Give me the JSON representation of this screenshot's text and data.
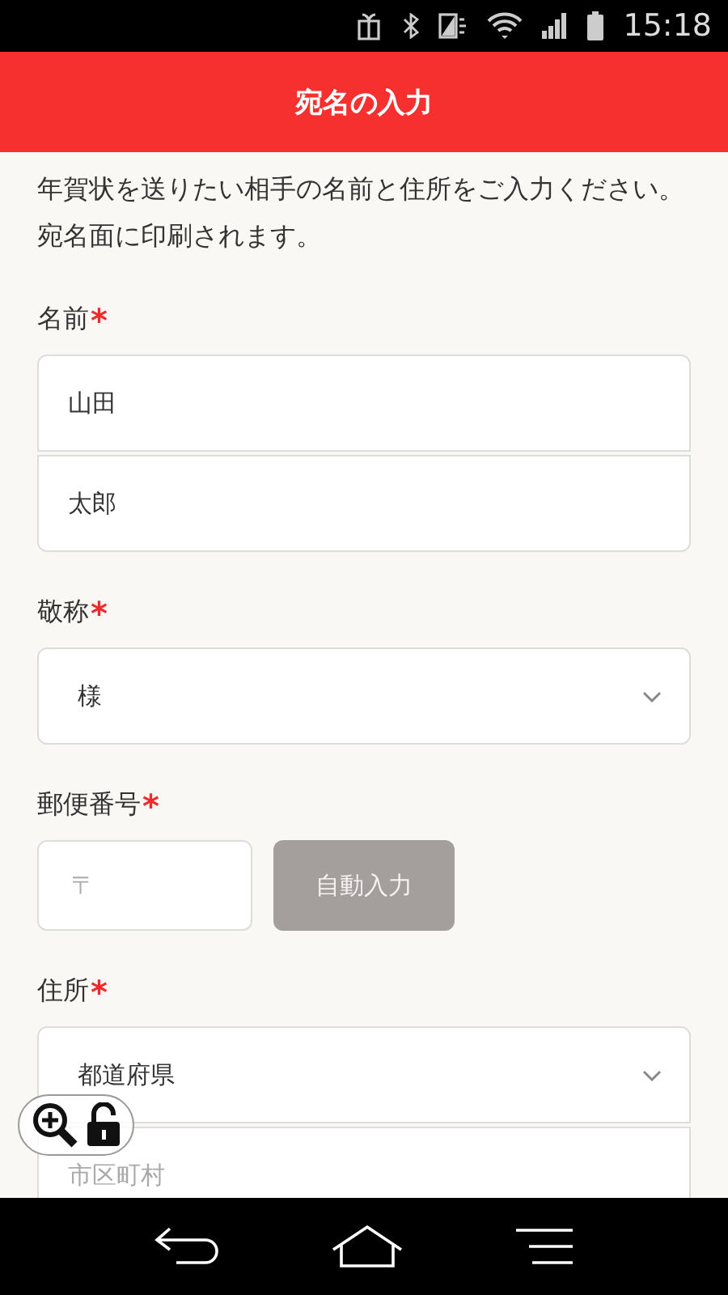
{
  "status_bar": {
    "time": "15:18"
  },
  "header": {
    "title": "宛名の入力"
  },
  "intro": "年賀状を送りたい相手の名前と住所をご入力ください。宛名面に印刷されます。",
  "fields": [
    {
      "kind": "text-group",
      "label": "名前",
      "required_mark": "*",
      "inputs": [
        {
          "value": "山田"
        },
        {
          "value": "太郎"
        }
      ]
    },
    {
      "kind": "select",
      "label": "敬称",
      "required_mark": "*",
      "value": "様"
    },
    {
      "kind": "postal",
      "label": "郵便番号",
      "required_mark": "*",
      "placeholder": "〒",
      "button": "自動入力",
      "button_disabled": true
    },
    {
      "kind": "address",
      "label": "住所",
      "required_mark": "*",
      "select": {
        "value": "都道府県"
      },
      "inputs": [
        {
          "placeholder": "市区町村"
        }
      ]
    }
  ]
}
